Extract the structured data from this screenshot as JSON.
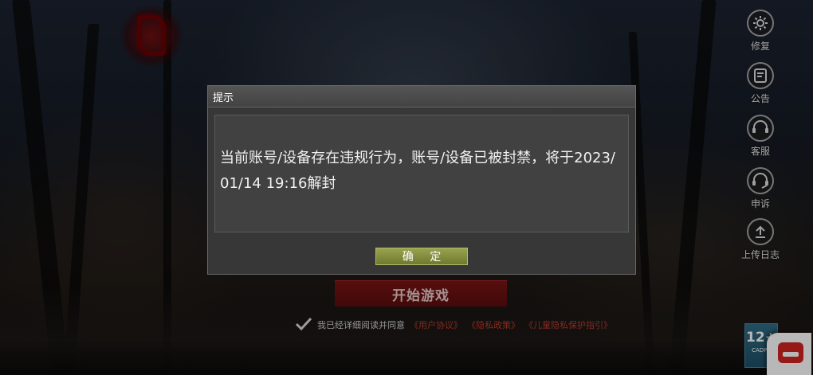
{
  "dialog": {
    "title": "提示",
    "message": "当前账号/设备存在违规行为，账号/设备已被封禁，将于2023/01/14 19:16解封",
    "confirm_label": "确 定"
  },
  "sidebar": {
    "items": [
      {
        "label": "修复",
        "icon": "gear-repair-icon"
      },
      {
        "label": "公告",
        "icon": "announcement-icon"
      },
      {
        "label": "客服",
        "icon": "customer-service-icon"
      },
      {
        "label": "申诉",
        "icon": "appeal-icon"
      },
      {
        "label": "上传日志",
        "icon": "upload-log-icon"
      }
    ]
  },
  "main": {
    "start_label": "开始游戏",
    "agreement_text": "我已经详细阅读并同意",
    "links": [
      "《用户协议》",
      "《隐私政策》",
      "《儿童隐私保护指引》"
    ]
  },
  "age_rating": {
    "value": "12+",
    "sub": "CADPA"
  },
  "colors": {
    "accent_red": "#7a1414",
    "confirm_green": "#8a9440",
    "dialog_bg": "#3a3a3a",
    "link_red": "#b83a2e"
  }
}
